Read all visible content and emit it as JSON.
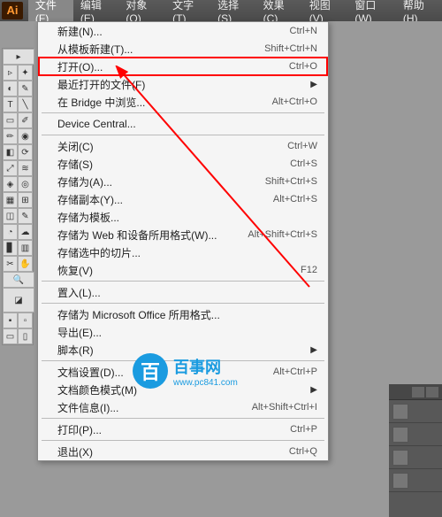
{
  "app_logo": "Ai",
  "menubar": [
    {
      "label": "文件(F)",
      "active": true
    },
    {
      "label": "编辑(E)"
    },
    {
      "label": "对象(O)"
    },
    {
      "label": "文字(T)"
    },
    {
      "label": "选择(S)"
    },
    {
      "label": "效果(C)"
    },
    {
      "label": "视图(V)"
    },
    {
      "label": "窗口(W)"
    },
    {
      "label": "帮助(H)"
    }
  ],
  "dropdown": [
    {
      "label": "新建(N)...",
      "shortcut": "Ctrl+N"
    },
    {
      "label": "从模板新建(T)...",
      "shortcut": "Shift+Ctrl+N"
    },
    {
      "label": "打开(O)...",
      "shortcut": "Ctrl+O",
      "highlighted": true
    },
    {
      "label": "最近打开的文件(F)",
      "submenu": true
    },
    {
      "label": "在 Bridge 中浏览...",
      "shortcut": "Alt+Ctrl+O"
    },
    {
      "sep": true
    },
    {
      "label": "Device Central..."
    },
    {
      "sep": true
    },
    {
      "label": "关闭(C)",
      "shortcut": "Ctrl+W"
    },
    {
      "label": "存储(S)",
      "shortcut": "Ctrl+S"
    },
    {
      "label": "存储为(A)...",
      "shortcut": "Shift+Ctrl+S"
    },
    {
      "label": "存储副本(Y)...",
      "shortcut": "Alt+Ctrl+S"
    },
    {
      "label": "存储为模板..."
    },
    {
      "label": "存储为 Web 和设备所用格式(W)...",
      "shortcut": "Alt+Shift+Ctrl+S"
    },
    {
      "label": "存储选中的切片..."
    },
    {
      "label": "恢复(V)",
      "shortcut": "F12"
    },
    {
      "sep": true
    },
    {
      "label": "置入(L)..."
    },
    {
      "sep": true
    },
    {
      "label": "存储为 Microsoft Office 所用格式..."
    },
    {
      "label": "导出(E)..."
    },
    {
      "label": "脚本(R)",
      "submenu": true
    },
    {
      "sep": true
    },
    {
      "label": "文档设置(D)...",
      "shortcut": "Alt+Ctrl+P"
    },
    {
      "label": "文档颜色模式(M)",
      "submenu": true
    },
    {
      "label": "文件信息(I)...",
      "shortcut": "Alt+Shift+Ctrl+I"
    },
    {
      "sep": true
    },
    {
      "label": "打印(P)...",
      "shortcut": "Ctrl+P"
    },
    {
      "sep": true
    },
    {
      "label": "退出(X)",
      "shortcut": "Ctrl+Q"
    }
  ],
  "watermark": {
    "char": "百",
    "title": "百事网",
    "url": "www.pc841.com"
  }
}
